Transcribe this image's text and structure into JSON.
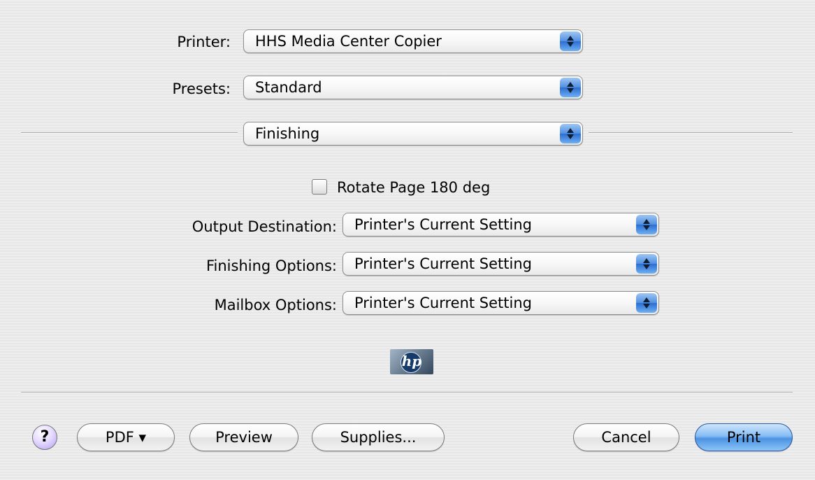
{
  "printer": {
    "label": "Printer:",
    "value": "HHS Media Center Copier"
  },
  "presets": {
    "label": "Presets:",
    "value": "Standard"
  },
  "pane": {
    "value": "Finishing"
  },
  "rotate": {
    "label": "Rotate Page 180 deg",
    "checked": false
  },
  "output_destination": {
    "label": "Output Destination:",
    "value": "Printer's Current Setting"
  },
  "finishing_options": {
    "label": "Finishing Options:",
    "value": "Printer's Current Setting"
  },
  "mailbox_options": {
    "label": "Mailbox Options:",
    "value": "Printer's Current Setting"
  },
  "logo": {
    "text": "hp"
  },
  "buttons": {
    "help": "?",
    "pdf": "PDF ▾",
    "preview": "Preview",
    "supplies": "Supplies...",
    "cancel": "Cancel",
    "print": "Print"
  },
  "colors": {
    "accent": "#4c92e3",
    "background": "#ececec"
  }
}
